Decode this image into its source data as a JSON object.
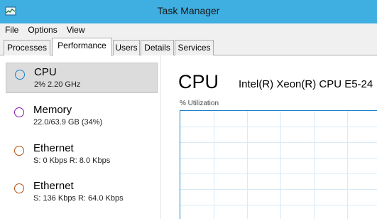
{
  "window": {
    "title": "Task Manager",
    "icon": "task-manager-icon"
  },
  "menu": [
    {
      "label": "File"
    },
    {
      "label": "Options"
    },
    {
      "label": "View"
    }
  ],
  "tabs": [
    {
      "label": "Processes",
      "active": false
    },
    {
      "label": "Performance",
      "active": true
    },
    {
      "label": "Users",
      "active": false
    },
    {
      "label": "Details",
      "active": false
    },
    {
      "label": "Services",
      "active": false
    }
  ],
  "sidebar": {
    "items": [
      {
        "name": "CPU",
        "sub": "2%  2.20 GHz",
        "color": "#1a80c6",
        "selected": true
      },
      {
        "name": "Memory",
        "sub": "22.0/63.9 GB (34%)",
        "color": "#8b16b3",
        "selected": false
      },
      {
        "name": "Ethernet",
        "sub": "S: 0 Kbps  R: 8.0 Kbps",
        "color": "#b34f0e",
        "selected": false
      },
      {
        "name": "Ethernet",
        "sub": "S: 136 Kbps  R: 64.0 Kbps",
        "color": "#b34f0e",
        "selected": false
      }
    ]
  },
  "main": {
    "title": "CPU",
    "model": "Intel(R) Xeon(R) CPU E5-24",
    "graph_label": "% Utilization",
    "graph_color": "#1a80c6"
  }
}
